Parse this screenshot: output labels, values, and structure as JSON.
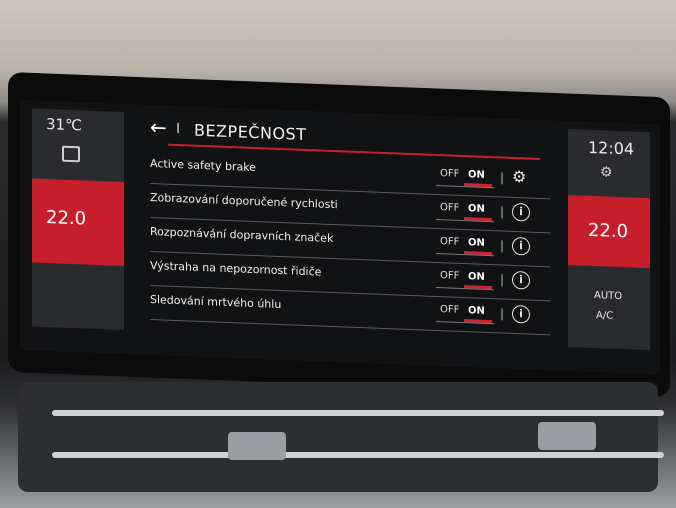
{
  "climate": {
    "outside_temp": "31℃",
    "left_temp": "22.0",
    "right_temp": "22.0",
    "auto_label": "AUTO",
    "ac_label": "A/C"
  },
  "status": {
    "clock": "12:04"
  },
  "header": {
    "title": "BEZPEČNOST",
    "separator": "I"
  },
  "settings": [
    {
      "label": "Active safety brake",
      "off": "OFF",
      "on": "ON",
      "state": "ON",
      "icon": "gear-icon"
    },
    {
      "label": "Zobrazování doporučené rychlosti",
      "off": "OFF",
      "on": "ON",
      "state": "ON",
      "icon": "info-icon"
    },
    {
      "label": "Rozpoznávání dopravních značek",
      "off": "OFF",
      "on": "ON",
      "state": "ON",
      "icon": "info-icon"
    },
    {
      "label": "Výstraha na nepozornost řidiče",
      "off": "OFF",
      "on": "ON",
      "state": "ON",
      "icon": "info-icon"
    },
    {
      "label": "Sledování mrtvého úhlu",
      "off": "OFF",
      "on": "ON",
      "state": "ON",
      "icon": "info-icon"
    }
  ],
  "colors": {
    "accent": "#c61f2b",
    "screen_bg": "#111214"
  }
}
